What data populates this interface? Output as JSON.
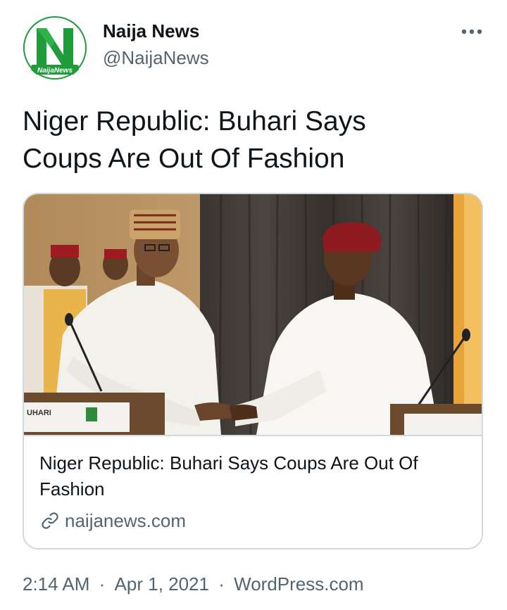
{
  "author": {
    "display_name": "Naija News",
    "handle": "@NaijaNews",
    "avatar_logo_text": "NaijaNews",
    "avatar_icon": "naija-news-logo"
  },
  "more_icon": "more-options-icon",
  "tweet": {
    "text": "Niger Republic: Buhari Says\nCoups Are Out Of Fashion"
  },
  "link_card": {
    "image_desc_icon": "article-photo",
    "podium_left_text": "UHARI",
    "title": "Niger Republic: Buhari Says Coups Are Out Of Fashion",
    "domain": "naijanews.com",
    "domain_icon": "link-icon"
  },
  "meta": {
    "time": "2:14 AM",
    "separator": "·",
    "date": "Apr 1, 2021",
    "source": "WordPress.com"
  },
  "colors": {
    "text_primary": "#0f1419",
    "text_secondary": "#536471",
    "border": "#cfd9de",
    "logo_green": "#1f9b3a"
  }
}
